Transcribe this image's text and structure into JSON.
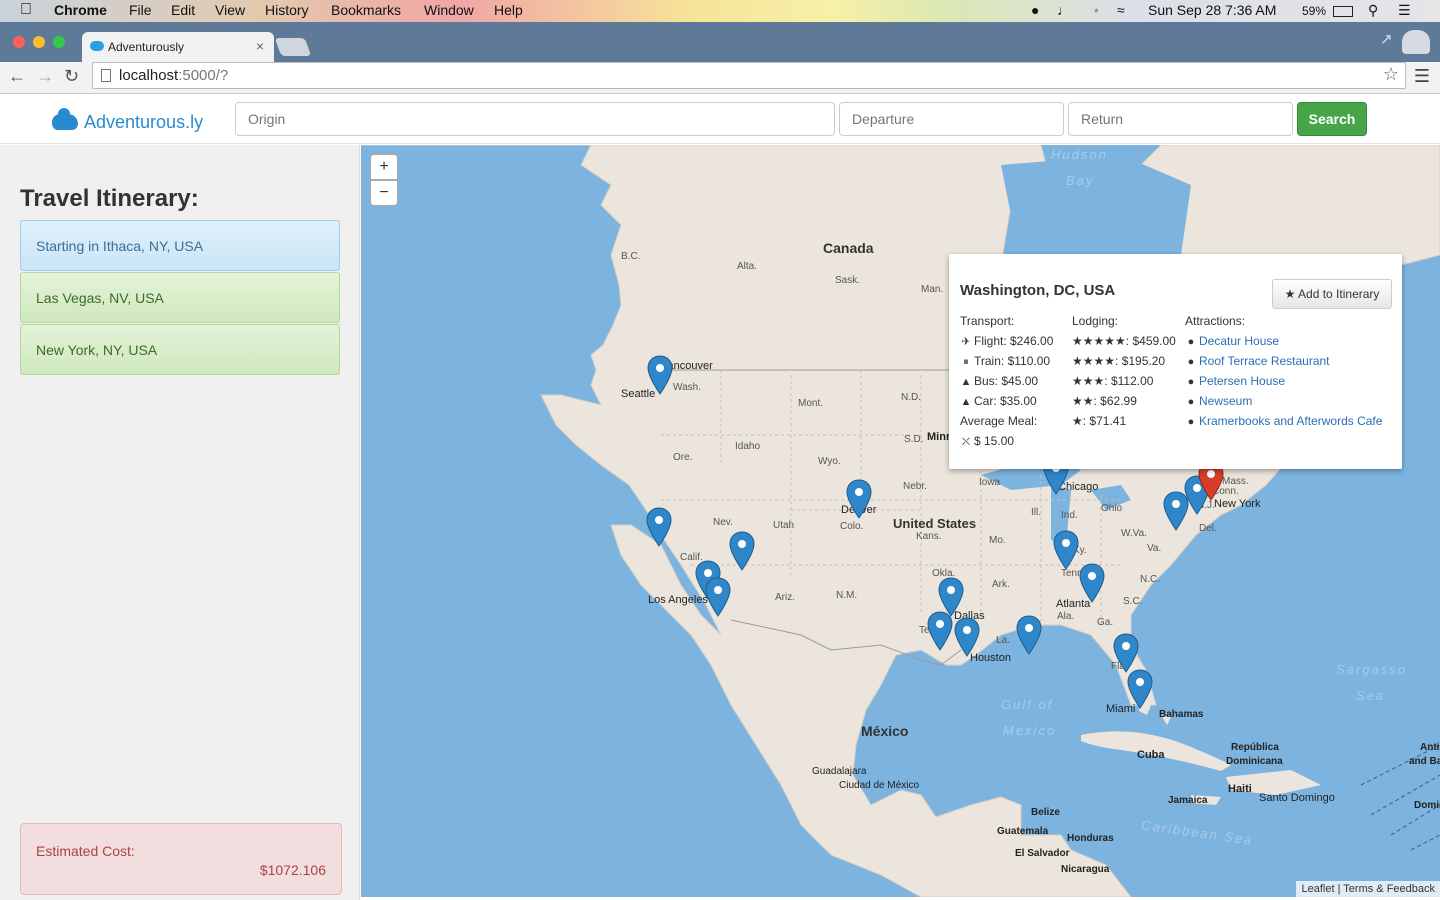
{
  "menubar": {
    "app": "Chrome",
    "items": [
      "File",
      "Edit",
      "View",
      "History",
      "Bookmarks",
      "Window",
      "Help"
    ],
    "clock": "Sun Sep 28  7:36 AM",
    "battery": "59%"
  },
  "browser": {
    "tab_title": "Adventurously",
    "url_host": "localhost",
    "url_rest": ":5000/?"
  },
  "navbar": {
    "brand": "Adventurous.ly",
    "origin_placeholder": "Origin",
    "departure_placeholder": "Departure",
    "return_placeholder": "Return",
    "search_label": "Search"
  },
  "sidebar": {
    "heading": "Travel Itinerary:",
    "stops": [
      "Starting in Ithaca, NY, USA",
      "Las Vegas, NV, USA",
      "New York, NY, USA"
    ],
    "cost_label": "Estimated Cost:",
    "cost_value": "$1072.106"
  },
  "map": {
    "zoom_in": "+",
    "zoom_out": "−",
    "attribution_leaflet": "Leaflet",
    "attribution_sep": " | ",
    "attribution_terms": "Terms & Feedback",
    "labels": {
      "canada": "Canada",
      "us": "United States",
      "mexico": "México",
      "hudson1": "Hudson",
      "hudson2": "Bay",
      "gulf1": "Gulf of",
      "gulf2": "Mexico",
      "sargasso1": "Sargasso",
      "sargasso2": "Sea",
      "caribbean": "Caribbean Sea",
      "bc": "B.C.",
      "alta": "Alta.",
      "sask": "Sask.",
      "man": "Man.",
      "wash": "Wash.",
      "ore": "Ore.",
      "idaho": "Idaho",
      "mont": "Mont.",
      "wyo": "Wyo.",
      "nd": "N.D.",
      "sd": "S.D.",
      "nebr": "Nebr.",
      "calif": "Calif.",
      "nev": "Nev.",
      "utah": "Utah",
      "colo": "Colo.",
      "kans": "Kans.",
      "ariz": "Ariz.",
      "nm": "N.M.",
      "okla": "Okla.",
      "tex": "Tex.",
      "mo": "Mo.",
      "ark": "Ark.",
      "la": "La.",
      "iowa": "Iowa",
      "ill": "Ill.",
      "ind": "Ind.",
      "ohio": "Ohio",
      "ky": "Ky.",
      "tenn": "Tenn.",
      "ala": "Ala.",
      "ga": "Ga.",
      "fla": "Fla.",
      "sc": "S.C.",
      "nc": "N.C.",
      "va": "Va.",
      "wva": "W.Va.",
      "del": "Del.",
      "nj": "N.J.",
      "mass": "Mass.",
      "conn": "Conn.",
      "minn": "Minn",
      "cuba": "Cuba",
      "haiti": "Haiti",
      "jamaica": "Jamaica",
      "bahamas": "Bahamas",
      "repdom1": "República",
      "repdom2": "Dominicana",
      "belize": "Belize",
      "guatemala": "Guatemala",
      "honduras": "Honduras",
      "elsalvador": "El Salvador",
      "nicaragua": "Nicaragua",
      "anti1": "Anti",
      "anti2": "and Ba",
      "domin": "Domin"
    },
    "cities": {
      "vancouver": "Vancouver",
      "seattle": "Seattle",
      "losangeles": "Los Angeles",
      "denver": "Denver",
      "chicago": "Chicago",
      "newyork": "New York",
      "dallas": "Dallas",
      "houston": "Houston",
      "atlanta": "Atlanta",
      "miami": "Miami",
      "guadalajara": "Guadalajara",
      "ciudad": "Ciudad de México",
      "santodomingo": "Santo Domingo"
    }
  },
  "popup": {
    "title": "Washington, DC, USA",
    "add_button": "Add to Itinerary",
    "transport_heading": "Transport:",
    "transport": [
      {
        "icon": "plane-icon",
        "glyph": "✈",
        "text": "Flight: $246.00"
      },
      {
        "icon": "train-icon",
        "glyph": "⏸",
        "text": "Train: $110.00"
      },
      {
        "icon": "bus-icon",
        "glyph": "▲",
        "text": "Bus: $45.00"
      },
      {
        "icon": "car-icon",
        "glyph": "▲",
        "text": "Car: $35.00"
      }
    ],
    "meal_heading": "Average Meal:",
    "meal_value": "$ 15.00",
    "lodging_heading": "Lodging:",
    "lodging": [
      {
        "stars": "★★★★★",
        "text": ": $459.00"
      },
      {
        "stars": "★★★★",
        "text": ": $195.20"
      },
      {
        "stars": "★★★",
        "text": ": $112.00"
      },
      {
        "stars": "★★",
        "text": ": $62.99"
      },
      {
        "stars": "★",
        "text": ": $71.41"
      }
    ],
    "attractions_heading": "Attractions:",
    "attractions": [
      "Decatur House",
      "Roof Terrace Restaurant",
      "Petersen House",
      "Newseum",
      "Kramerbooks and Afterwords Cafe"
    ]
  },
  "colors": {
    "water": "#7cb4df",
    "land": "#ece5dd",
    "pin_blue": "#2f86c8",
    "pin_red": "#d63e2a",
    "success": "#47a447"
  }
}
